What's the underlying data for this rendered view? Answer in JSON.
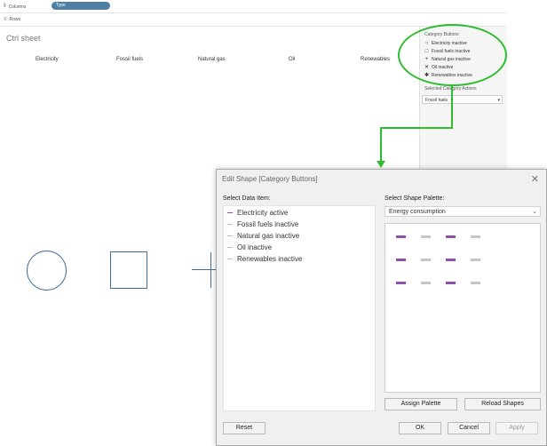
{
  "shelves": {
    "columns_label": "Columns",
    "columns_pill": "Type",
    "rows_label": "Rows"
  },
  "sheet": {
    "title": "Ctrl sheet",
    "column_headers": [
      "Electricity",
      "Fossil fuels",
      "Natural gas",
      "Oil",
      "Renewables"
    ]
  },
  "legend": {
    "title": "Category Buttons",
    "items": [
      {
        "glyph": "○",
        "label": "Electricity inactive"
      },
      {
        "glyph": "□",
        "label": "Fossil fuels inactive"
      },
      {
        "glyph": "+",
        "label": "Natural gas inactive"
      },
      {
        "glyph": "✕",
        "label": "Oil inactive"
      },
      {
        "glyph": "✱",
        "label": "Renewables inactive"
      }
    ]
  },
  "filter": {
    "title": "Selected Category Actions",
    "value": "Fossil fuels"
  },
  "dialog": {
    "title": "Edit Shape [Category Buttons]",
    "select_data_item_label": "Select Data Item:",
    "select_palette_label": "Select Shape Palette:",
    "palette_value": "Energy consumption",
    "data_items": [
      {
        "label": "Electricity active",
        "color": "#8e4fae"
      },
      {
        "label": "Fossil fuels inactive",
        "color": "#bdbdbd"
      },
      {
        "label": "Natural gas inactive",
        "color": "#bdbdbd"
      },
      {
        "label": "Oil inactive",
        "color": "#bdbdbd"
      },
      {
        "label": "Renewables inactive",
        "color": "#bdbdbd"
      }
    ],
    "palette_colors": {
      "active": "#8e4fae",
      "inactive": "#c4c4c4"
    },
    "buttons": {
      "assign_palette": "Assign Palette",
      "reload_shapes": "Reload Shapes",
      "reset": "Reset",
      "ok": "OK",
      "cancel": "Cancel",
      "apply": "Apply"
    },
    "close_icon": "close-icon"
  },
  "annotation_color": "#2fbd2f"
}
